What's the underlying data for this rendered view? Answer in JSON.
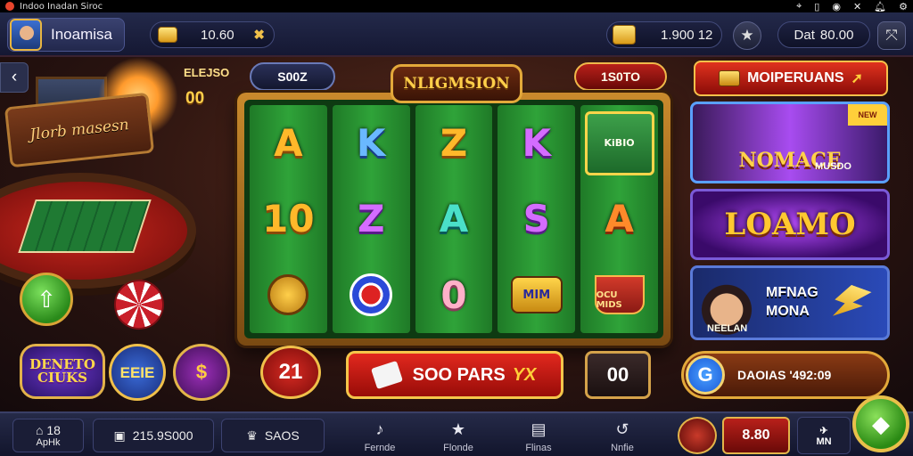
{
  "status_bar": {
    "title": "Indoo Inadan Siroc",
    "icons": [
      "location-icon",
      "vibrate-icon",
      "wifi-icon",
      "close-icon",
      "bell-icon",
      "gear-icon"
    ]
  },
  "topbar": {
    "player_name": "Inoamisa",
    "coins": "10.60",
    "gems": "1.900 12",
    "balance_label": "Dat",
    "balance_value": "80.00"
  },
  "left_panel": {
    "badge_top": "ELEJSO",
    "badge_num": "00",
    "sign_text": "Jlorb masesn",
    "game_icons": [
      "DENETO CIUKS",
      "EEIE",
      "$"
    ]
  },
  "slot": {
    "title": "NLIGMSION",
    "left_pill": "S00Z",
    "right_pill": "1S0TO",
    "reels": [
      [
        {
          "t": "A",
          "c": "c-gold"
        },
        {
          "t": "10",
          "c": "c-gold"
        },
        {
          "t": "",
          "c": "c-snake"
        }
      ],
      [
        {
          "t": "K",
          "c": "c-blue"
        },
        {
          "t": "Z",
          "c": "c-purple"
        },
        {
          "t": "",
          "c": "c-ring"
        }
      ],
      [
        {
          "t": "Z",
          "c": "c-gold"
        },
        {
          "t": "A",
          "c": "c-teal"
        },
        {
          "t": "0",
          "c": "c-pink"
        }
      ],
      [
        {
          "t": "K",
          "c": "c-purple"
        },
        {
          "t": "S",
          "c": "c-purple"
        },
        {
          "t": "MIM",
          "c": "c-badge"
        }
      ],
      [
        {
          "t": "KiBIO",
          "c": "c-card"
        },
        {
          "t": "A",
          "c": "c-orange"
        },
        {
          "t": "OCU MIDS",
          "c": "c-cup"
        }
      ]
    ]
  },
  "controls": {
    "bet": "21",
    "spin_label": "SOO PARS",
    "spin_mult": "YX",
    "auto": "00"
  },
  "promos": {
    "header": "MOIPERUANS",
    "card1_title": "NOMACE",
    "card1_sub": "MUSDO",
    "card1_tag": "NEW",
    "card2_title": "LOAMO",
    "card3_line1": "MFNAG",
    "card3_line2": "MONA",
    "card3_caption": "NEELAN",
    "reward_text": "DAOIAS '492:09",
    "reward_icon_letter": "G"
  },
  "bottom_nav": {
    "home_label": "ApHk",
    "home_num": "18",
    "cash": "215.9S000",
    "bag": "SAOS",
    "tabs": [
      "Fernde",
      "Flonde",
      "Flinas",
      "Nnfie"
    ],
    "score": "8.80",
    "mini": "MN"
  },
  "colors": {
    "accent_gold": "#f0c04a",
    "spin_red": "#e2281e",
    "felt_green": "#2fa339"
  }
}
